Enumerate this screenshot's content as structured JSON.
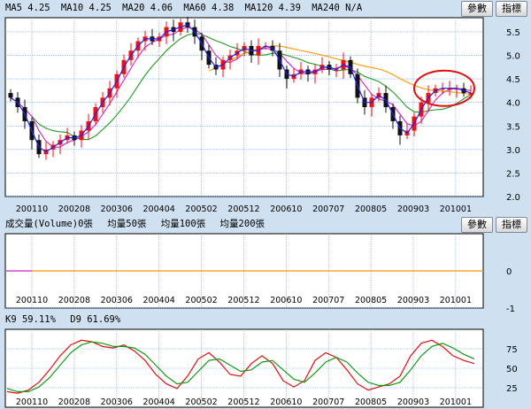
{
  "price_panel": {
    "indicators": [
      {
        "label": "MA5",
        "value": "4.25"
      },
      {
        "label": "MA10",
        "value": "4.25"
      },
      {
        "label": "MA20",
        "value": "4.06"
      },
      {
        "label": "MA60",
        "value": "4.38"
      },
      {
        "label": "MA120",
        "value": "4.39"
      },
      {
        "label": "MA240",
        "value": "N/A"
      }
    ],
    "param_button": "參數",
    "indicator_button": "指標"
  },
  "volume_panel": {
    "title": "成交量(Volume)",
    "volume": "0張",
    "avg5_label": "均量5",
    "avg5": "0張",
    "avg10_label": "均量10",
    "avg10": "0張",
    "avg20_label": "均量20",
    "avg20": "0張",
    "param_button": "參數",
    "indicator_button": "指標"
  },
  "kd_panel": {
    "k_label": "K9",
    "k_value": "59.11%",
    "d_label": "D9",
    "d_value": "61.69%"
  },
  "colors": {
    "up": "#ee1111",
    "down": "#111111",
    "ma5": "#2020ee",
    "ma10": "#cc22cc",
    "ma20": "#229922",
    "ma60": "#ff9900",
    "k_line": "#dd1111",
    "d_line": "#119911",
    "highlight": "#dd1111",
    "grid": "#7a9ccc",
    "bg": "#ffffff"
  },
  "chart_data": [
    {
      "type": "candlestick",
      "x_tick_labels": [
        "200110",
        "200208",
        "200306",
        "200404",
        "200502",
        "200512",
        "200610",
        "200707",
        "200805",
        "200903",
        "201001"
      ],
      "y_ticks": [
        2.0,
        2.5,
        3.0,
        3.5,
        4.0,
        4.5,
        5.0,
        5.5
      ],
      "ylim": [
        2.0,
        5.8
      ],
      "approx_close": [
        4.1,
        3.9,
        3.6,
        3.2,
        2.9,
        3.0,
        3.1,
        3.2,
        3.3,
        3.2,
        3.4,
        3.6,
        3.9,
        4.1,
        4.3,
        4.6,
        4.9,
        5.1,
        5.3,
        5.4,
        5.3,
        5.4,
        5.6,
        5.5,
        5.7,
        5.6,
        5.4,
        5.1,
        4.8,
        4.7,
        4.9,
        5.0,
        5.1,
        5.2,
        5.0,
        5.2,
        5.2,
        5.1,
        4.7,
        4.5,
        4.6,
        4.7,
        4.6,
        4.7,
        4.8,
        4.7,
        4.7,
        4.9,
        4.6,
        4.1,
        3.9,
        4.1,
        4.2,
        3.9,
        3.6,
        3.3,
        3.4,
        3.7,
        4.0,
        4.2,
        4.3,
        4.3,
        4.3,
        4.3,
        4.2,
        4.2
      ],
      "series": [
        {
          "name": "MA5",
          "value": 4.25
        },
        {
          "name": "MA10",
          "value": 4.25
        },
        {
          "name": "MA20",
          "value": 4.06
        },
        {
          "name": "MA60",
          "value": 4.38
        },
        {
          "name": "MA120",
          "value": 4.39
        }
      ],
      "annotation": "red ellipse around latest candles"
    },
    {
      "type": "bar",
      "title": "成交量(Volume)",
      "x_tick_labels": [
        "200110",
        "200208",
        "200306",
        "200404",
        "200502",
        "200512",
        "200610",
        "200707",
        "200805",
        "200903",
        "201001"
      ],
      "y_ticks": [
        0,
        -1
      ],
      "ylim": [
        -1,
        1
      ],
      "values": []
    },
    {
      "type": "line",
      "x_tick_labels": [
        "200110",
        "200208",
        "200306",
        "200404",
        "200502",
        "200512",
        "200610",
        "200707",
        "200805",
        "200903",
        "201001"
      ],
      "y_ticks": [
        25,
        50,
        75
      ],
      "ylim": [
        0,
        100
      ],
      "series": [
        {
          "name": "K9",
          "values": [
            20,
            18,
            22,
            32,
            48,
            66,
            80,
            86,
            84,
            78,
            76,
            80,
            72,
            60,
            42,
            30,
            24,
            40,
            62,
            70,
            58,
            42,
            40,
            56,
            66,
            56,
            34,
            26,
            34,
            60,
            70,
            64,
            48,
            30,
            22,
            26,
            30,
            40,
            66,
            82,
            86,
            78,
            66,
            60,
            56
          ]
        },
        {
          "name": "D9",
          "values": [
            24,
            20,
            20,
            26,
            38,
            54,
            70,
            80,
            84,
            82,
            78,
            78,
            76,
            68,
            54,
            40,
            30,
            32,
            46,
            60,
            62,
            54,
            46,
            48,
            58,
            60,
            48,
            36,
            32,
            44,
            58,
            64,
            58,
            44,
            32,
            28,
            28,
            32,
            48,
            66,
            78,
            82,
            76,
            68,
            62
          ]
        }
      ]
    }
  ]
}
